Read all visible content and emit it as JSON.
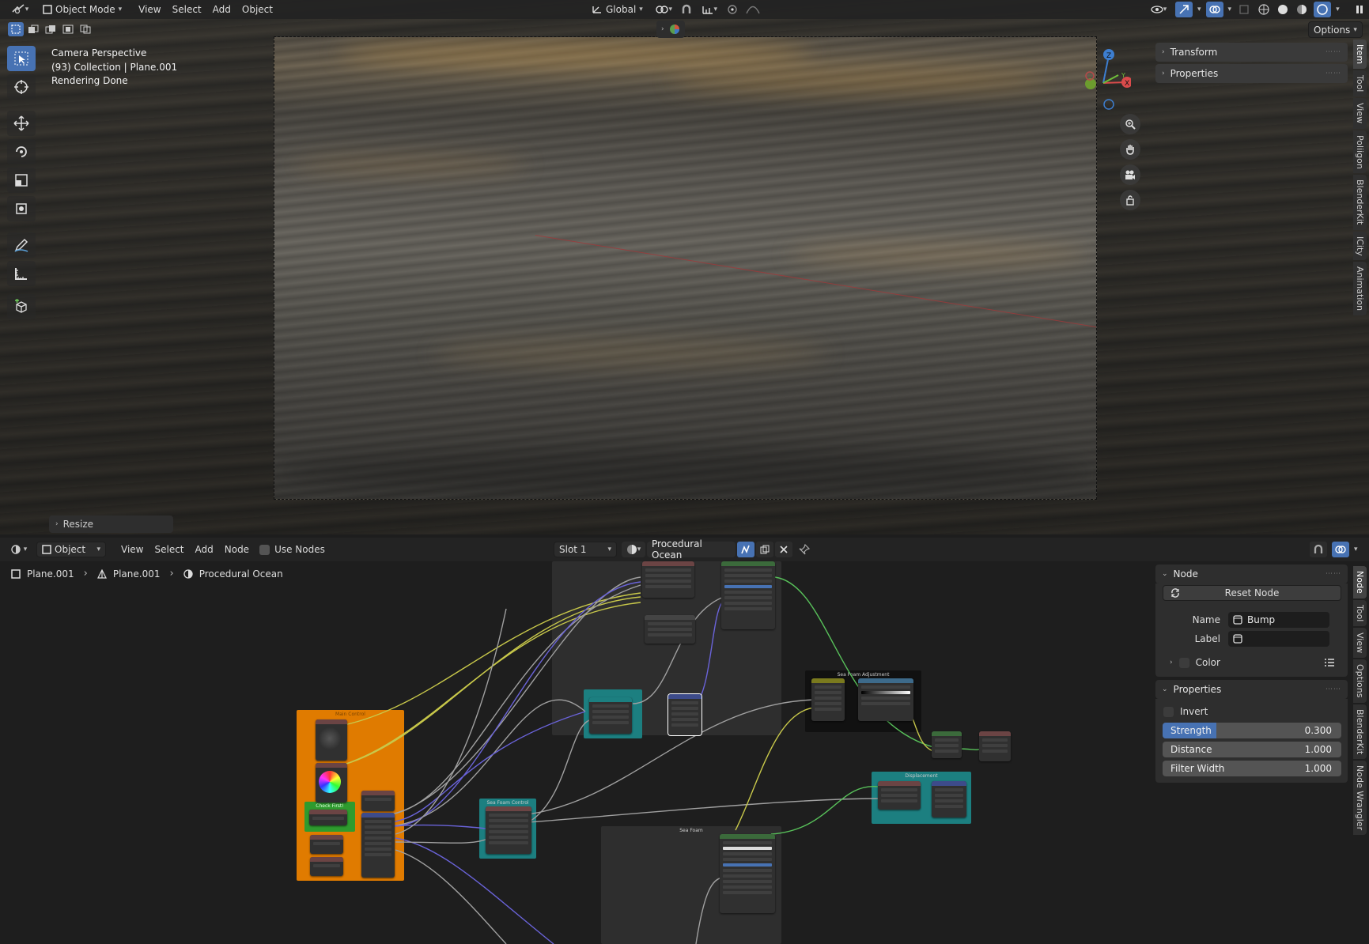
{
  "viewport": {
    "mode": "Object Mode",
    "menus": [
      "View",
      "Select",
      "Add",
      "Object"
    ],
    "orientation": "Global",
    "options_label": "Options",
    "overlay": {
      "line1": "Camera Perspective",
      "line2": "(93) Collection | Plane.001",
      "line3": "Rendering Done"
    },
    "n_panel": [
      {
        "label": "Transform"
      },
      {
        "label": "Properties"
      }
    ],
    "tabs": [
      "Item",
      "Tool",
      "View",
      "Poliigon",
      "BlenderKit",
      "ICity",
      "Animation"
    ],
    "resize_label": "Resize",
    "gizmo": {
      "z": "Z",
      "y": "Y",
      "x": "X"
    }
  },
  "node_editor": {
    "type": "Object",
    "menus": [
      "View",
      "Select",
      "Add",
      "Node"
    ],
    "use_nodes_label": "Use Nodes",
    "slot": "Slot 1",
    "material": "Procedural Ocean",
    "breadcrumb": [
      "Plane.001",
      "Plane.001",
      "Procedural Ocean"
    ],
    "frames": {
      "sea_foam_adjustment": "Sea Foam Adjustment",
      "sea_foam_control": "Sea Foam Control",
      "sea_foam": "Sea Foam",
      "displacement": "Displacement",
      "main_control": "Main Control",
      "check_first": "Check First!"
    },
    "sidebar": {
      "node_title": "Node",
      "reset_node": "Reset Node",
      "name_label": "Name",
      "name_value": "Bump",
      "label_label": "Label",
      "label_value": "",
      "color_label": "Color",
      "properties_title": "Properties",
      "invert_label": "Invert",
      "strength_label": "Strength",
      "strength_value": "0.300",
      "strength_fraction": 0.3,
      "distance_label": "Distance",
      "distance_value": "1.000",
      "filter_width_label": "Filter Width",
      "filter_width_value": "1.000"
    },
    "tabs": [
      "Node",
      "Tool",
      "View",
      "Options",
      "BlenderKit",
      "Node Wrangler"
    ]
  },
  "colors": {
    "accent": "#4772b3",
    "frame_orange": "#e07b00",
    "frame_teal": "#1c7f80",
    "wire_yellow": "#c8c84a",
    "wire_purple": "#6a63d9",
    "wire_gray": "#a0a0a0",
    "wire_green": "#58c15a"
  }
}
